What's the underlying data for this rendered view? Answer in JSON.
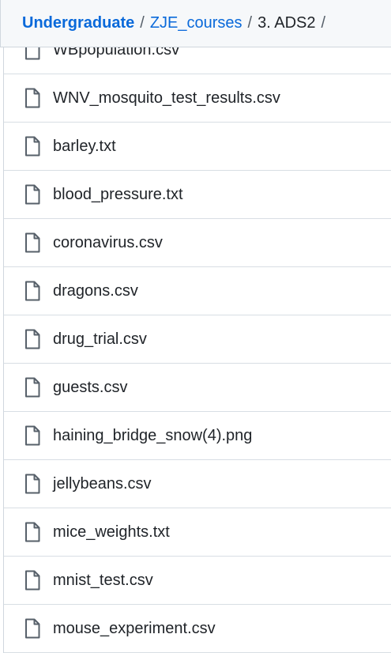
{
  "breadcrumb": {
    "items": [
      {
        "label": "Undergraduate"
      },
      {
        "label": "ZJE_courses"
      }
    ],
    "current": "3. ADS2",
    "separator": "/"
  },
  "files": [
    {
      "name": "WBpopulation.csv",
      "icon": "file-icon"
    },
    {
      "name": "WNV_mosquito_test_results.csv",
      "icon": "file-icon"
    },
    {
      "name": "barley.txt",
      "icon": "file-icon"
    },
    {
      "name": "blood_pressure.txt",
      "icon": "file-icon"
    },
    {
      "name": "coronavirus.csv",
      "icon": "file-icon"
    },
    {
      "name": "dragons.csv",
      "icon": "file-icon"
    },
    {
      "name": "drug_trial.csv",
      "icon": "file-icon"
    },
    {
      "name": "guests.csv",
      "icon": "file-icon"
    },
    {
      "name": "haining_bridge_snow(4).png",
      "icon": "file-icon"
    },
    {
      "name": "jellybeans.csv",
      "icon": "file-icon"
    },
    {
      "name": "mice_weights.txt",
      "icon": "file-icon"
    },
    {
      "name": "mnist_test.csv",
      "icon": "file-icon"
    },
    {
      "name": "mouse_experiment.csv",
      "icon": "file-icon"
    }
  ]
}
